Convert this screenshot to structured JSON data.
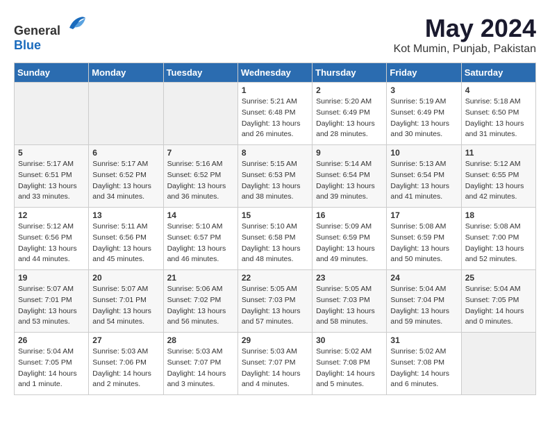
{
  "header": {
    "logo_general": "General",
    "logo_blue": "Blue",
    "month_year": "May 2024",
    "location": "Kot Mumin, Punjab, Pakistan"
  },
  "days_of_week": [
    "Sunday",
    "Monday",
    "Tuesday",
    "Wednesday",
    "Thursday",
    "Friday",
    "Saturday"
  ],
  "weeks": [
    [
      {
        "day": "",
        "info": ""
      },
      {
        "day": "",
        "info": ""
      },
      {
        "day": "",
        "info": ""
      },
      {
        "day": "1",
        "info": "Sunrise: 5:21 AM\nSunset: 6:48 PM\nDaylight: 13 hours\nand 26 minutes."
      },
      {
        "day": "2",
        "info": "Sunrise: 5:20 AM\nSunset: 6:49 PM\nDaylight: 13 hours\nand 28 minutes."
      },
      {
        "day": "3",
        "info": "Sunrise: 5:19 AM\nSunset: 6:49 PM\nDaylight: 13 hours\nand 30 minutes."
      },
      {
        "day": "4",
        "info": "Sunrise: 5:18 AM\nSunset: 6:50 PM\nDaylight: 13 hours\nand 31 minutes."
      }
    ],
    [
      {
        "day": "5",
        "info": "Sunrise: 5:17 AM\nSunset: 6:51 PM\nDaylight: 13 hours\nand 33 minutes."
      },
      {
        "day": "6",
        "info": "Sunrise: 5:17 AM\nSunset: 6:52 PM\nDaylight: 13 hours\nand 34 minutes."
      },
      {
        "day": "7",
        "info": "Sunrise: 5:16 AM\nSunset: 6:52 PM\nDaylight: 13 hours\nand 36 minutes."
      },
      {
        "day": "8",
        "info": "Sunrise: 5:15 AM\nSunset: 6:53 PM\nDaylight: 13 hours\nand 38 minutes."
      },
      {
        "day": "9",
        "info": "Sunrise: 5:14 AM\nSunset: 6:54 PM\nDaylight: 13 hours\nand 39 minutes."
      },
      {
        "day": "10",
        "info": "Sunrise: 5:13 AM\nSunset: 6:54 PM\nDaylight: 13 hours\nand 41 minutes."
      },
      {
        "day": "11",
        "info": "Sunrise: 5:12 AM\nSunset: 6:55 PM\nDaylight: 13 hours\nand 42 minutes."
      }
    ],
    [
      {
        "day": "12",
        "info": "Sunrise: 5:12 AM\nSunset: 6:56 PM\nDaylight: 13 hours\nand 44 minutes."
      },
      {
        "day": "13",
        "info": "Sunrise: 5:11 AM\nSunset: 6:56 PM\nDaylight: 13 hours\nand 45 minutes."
      },
      {
        "day": "14",
        "info": "Sunrise: 5:10 AM\nSunset: 6:57 PM\nDaylight: 13 hours\nand 46 minutes."
      },
      {
        "day": "15",
        "info": "Sunrise: 5:10 AM\nSunset: 6:58 PM\nDaylight: 13 hours\nand 48 minutes."
      },
      {
        "day": "16",
        "info": "Sunrise: 5:09 AM\nSunset: 6:59 PM\nDaylight: 13 hours\nand 49 minutes."
      },
      {
        "day": "17",
        "info": "Sunrise: 5:08 AM\nSunset: 6:59 PM\nDaylight: 13 hours\nand 50 minutes."
      },
      {
        "day": "18",
        "info": "Sunrise: 5:08 AM\nSunset: 7:00 PM\nDaylight: 13 hours\nand 52 minutes."
      }
    ],
    [
      {
        "day": "19",
        "info": "Sunrise: 5:07 AM\nSunset: 7:01 PM\nDaylight: 13 hours\nand 53 minutes."
      },
      {
        "day": "20",
        "info": "Sunrise: 5:07 AM\nSunset: 7:01 PM\nDaylight: 13 hours\nand 54 minutes."
      },
      {
        "day": "21",
        "info": "Sunrise: 5:06 AM\nSunset: 7:02 PM\nDaylight: 13 hours\nand 56 minutes."
      },
      {
        "day": "22",
        "info": "Sunrise: 5:05 AM\nSunset: 7:03 PM\nDaylight: 13 hours\nand 57 minutes."
      },
      {
        "day": "23",
        "info": "Sunrise: 5:05 AM\nSunset: 7:03 PM\nDaylight: 13 hours\nand 58 minutes."
      },
      {
        "day": "24",
        "info": "Sunrise: 5:04 AM\nSunset: 7:04 PM\nDaylight: 13 hours\nand 59 minutes."
      },
      {
        "day": "25",
        "info": "Sunrise: 5:04 AM\nSunset: 7:05 PM\nDaylight: 14 hours\nand 0 minutes."
      }
    ],
    [
      {
        "day": "26",
        "info": "Sunrise: 5:04 AM\nSunset: 7:05 PM\nDaylight: 14 hours\nand 1 minute."
      },
      {
        "day": "27",
        "info": "Sunrise: 5:03 AM\nSunset: 7:06 PM\nDaylight: 14 hours\nand 2 minutes."
      },
      {
        "day": "28",
        "info": "Sunrise: 5:03 AM\nSunset: 7:07 PM\nDaylight: 14 hours\nand 3 minutes."
      },
      {
        "day": "29",
        "info": "Sunrise: 5:03 AM\nSunset: 7:07 PM\nDaylight: 14 hours\nand 4 minutes."
      },
      {
        "day": "30",
        "info": "Sunrise: 5:02 AM\nSunset: 7:08 PM\nDaylight: 14 hours\nand 5 minutes."
      },
      {
        "day": "31",
        "info": "Sunrise: 5:02 AM\nSunset: 7:08 PM\nDaylight: 14 hours\nand 6 minutes."
      },
      {
        "day": "",
        "info": ""
      }
    ]
  ]
}
